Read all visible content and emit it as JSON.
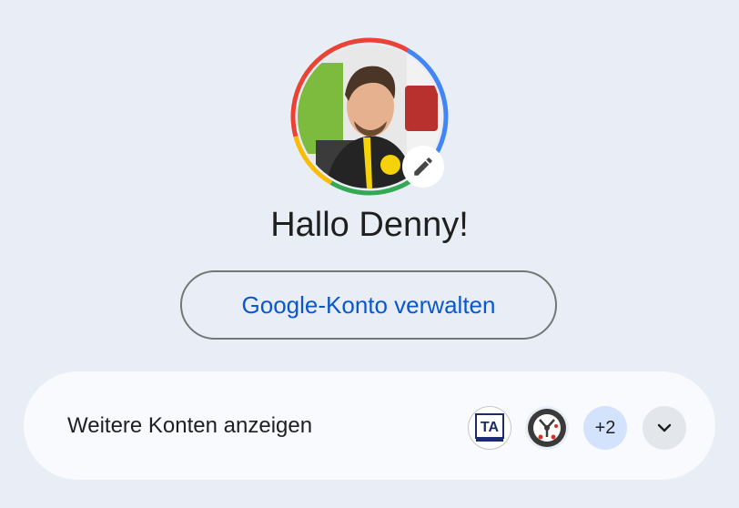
{
  "profile": {
    "greeting": "Hallo Denny!",
    "avatar_icon": "profile-photo",
    "edit_icon": "pencil-icon"
  },
  "manage_account": {
    "label": "Google-Konto verwalten"
  },
  "other_accounts": {
    "label": "Weitere Konten anzeigen",
    "accounts": [
      {
        "icon": "techarena-logo",
        "logo_text": "TA"
      },
      {
        "icon": "gauge-logo"
      }
    ],
    "more_count": "+2",
    "expand_icon": "chevron-down-icon"
  },
  "colors": {
    "background": "#e9eef6",
    "card": "#f8fafd",
    "accent_blue": "#0b57d0",
    "ring_red": "#ea4335",
    "ring_blue": "#4285f4",
    "ring_green": "#34a853",
    "ring_yellow": "#fbbc04"
  }
}
